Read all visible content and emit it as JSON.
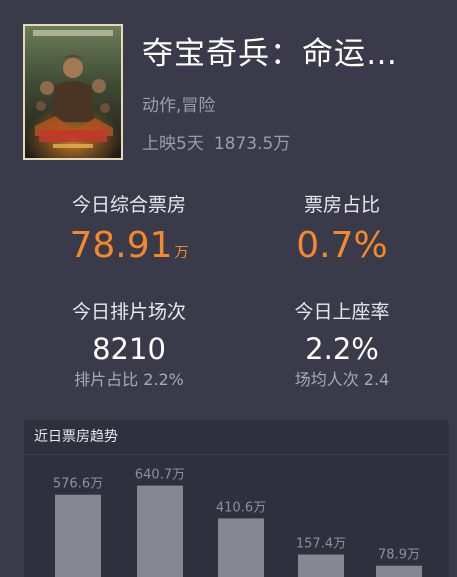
{
  "movie": {
    "title": "夺宝奇兵：命运…",
    "genre": "动作,冒险",
    "release_days": "上映5天",
    "total_box_office": "1873.5万"
  },
  "stats": {
    "today_box_office": {
      "label": "今日综合票房",
      "value": "78.91",
      "unit": "万"
    },
    "box_office_share": {
      "label": "票房占比",
      "value": "0.7%"
    },
    "today_screenings": {
      "label": "今日排片场次",
      "value": "8210",
      "sub": "排片占比 2.2%"
    },
    "today_occupancy": {
      "label": "今日上座率",
      "value": "2.2%",
      "sub": "场均人次 2.4"
    }
  },
  "trend": {
    "title": "近日票房趋势"
  },
  "colors": {
    "background": "#393a4a",
    "accent": "#f5882a",
    "bar": "#878791",
    "muted_text": "#9c9cab"
  },
  "chart_data": {
    "type": "bar",
    "title": "近日票房趋势",
    "categories": [
      "",
      "",
      "",
      "",
      ""
    ],
    "values": [
      576.6,
      640.7,
      410.6,
      157.4,
      78.9
    ],
    "value_labels": [
      "576.6万",
      "640.7万",
      "410.6万",
      "157.4万",
      "78.9万"
    ],
    "unit": "万",
    "ylim": [
      0,
      1100
    ],
    "grid": false
  }
}
